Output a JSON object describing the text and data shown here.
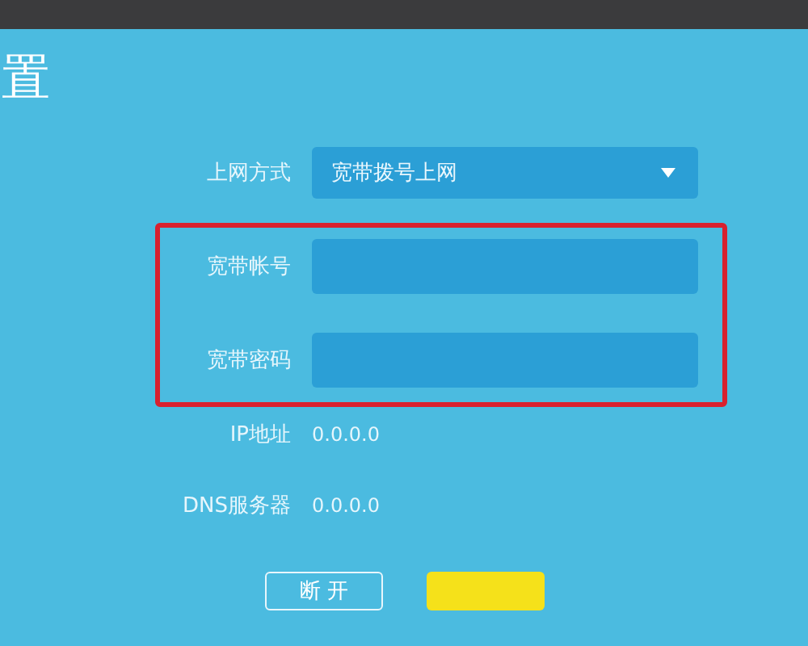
{
  "title": "置",
  "connection_type": {
    "label": "上网方式",
    "value": "宽带拨号上网"
  },
  "account_fields": {
    "highlighted": true,
    "fields": [
      {
        "label": "宽带帐号"
      },
      {
        "label": "宽带密码"
      }
    ]
  },
  "info": [
    {
      "label": "IP地址",
      "value": "0.0.0.0"
    },
    {
      "label": "DNS服务器",
      "value": "0.0.0.0"
    }
  ],
  "buttons": [
    {
      "kind": "outline",
      "label": "断 开"
    },
    {
      "kind": "primary"
    }
  ]
}
